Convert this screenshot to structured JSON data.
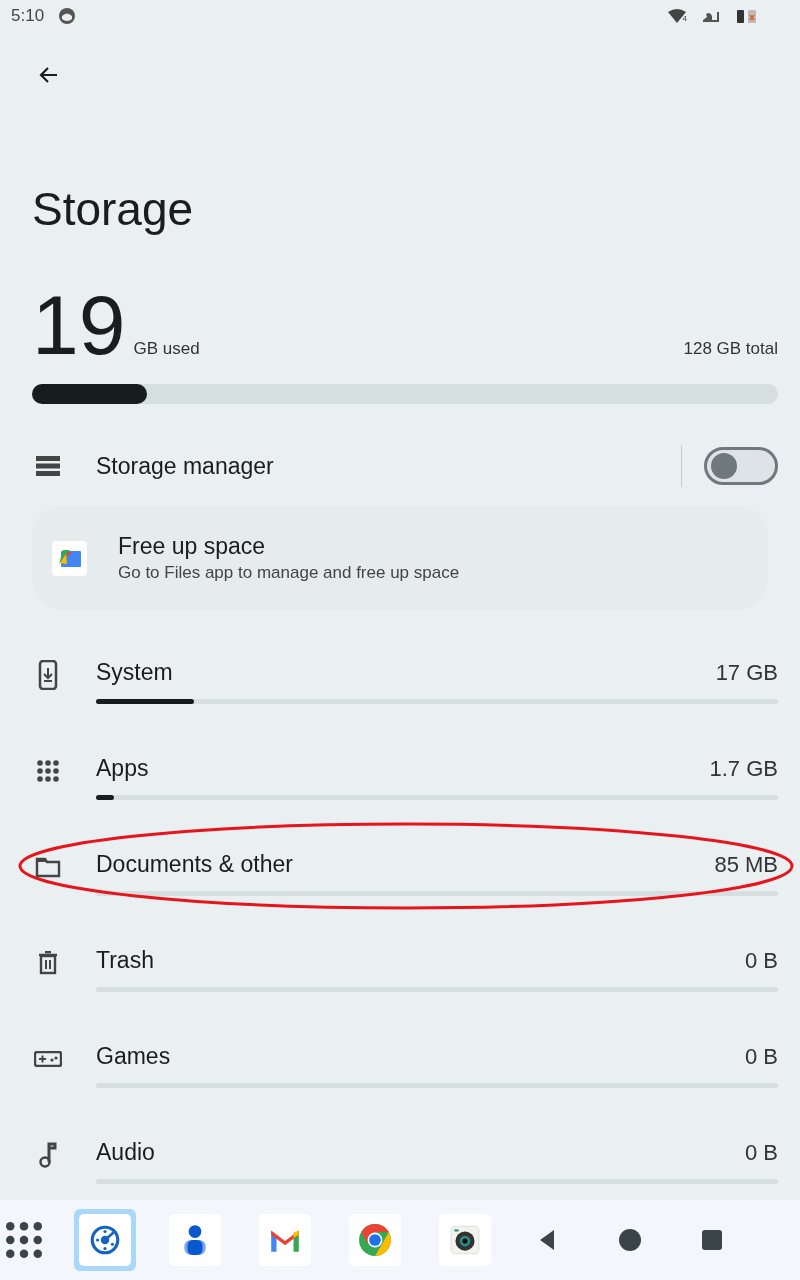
{
  "status_bar": {
    "time": "5:10",
    "wifi_badge": "4"
  },
  "title": "Storage",
  "usage": {
    "used_number": "19",
    "used_unit": "GB used",
    "total": "128 GB total",
    "level": 0.154
  },
  "storage_manager": {
    "label": "Storage manager",
    "on": false
  },
  "free_up_card": {
    "title": "Free up space",
    "subtitle": "Go to Files app to manage and free up space"
  },
  "categories": [
    {
      "kind": "system",
      "label": "System",
      "size": "17 GB",
      "level": 0.144,
      "highlighted": false
    },
    {
      "kind": "apps",
      "label": "Apps",
      "size": "1.7 GB",
      "level": 0.026,
      "highlighted": false
    },
    {
      "kind": "documents",
      "label": "Documents & other",
      "size": "85 MB",
      "highlighted": true
    },
    {
      "kind": "trash",
      "label": "Trash",
      "size": "0 B",
      "highlighted": false
    },
    {
      "kind": "games",
      "label": "Games",
      "size": "0 B",
      "highlighted": false
    },
    {
      "kind": "audio",
      "label": "Audio",
      "size": "0 B",
      "highlighted": false
    }
  ],
  "taskbar": {
    "apps": [
      {
        "kind": "settings",
        "selected": true
      },
      {
        "kind": "contacts",
        "selected": false
      },
      {
        "kind": "mail",
        "selected": false
      },
      {
        "kind": "browser",
        "selected": false
      },
      {
        "kind": "camera",
        "selected": false
      }
    ]
  }
}
